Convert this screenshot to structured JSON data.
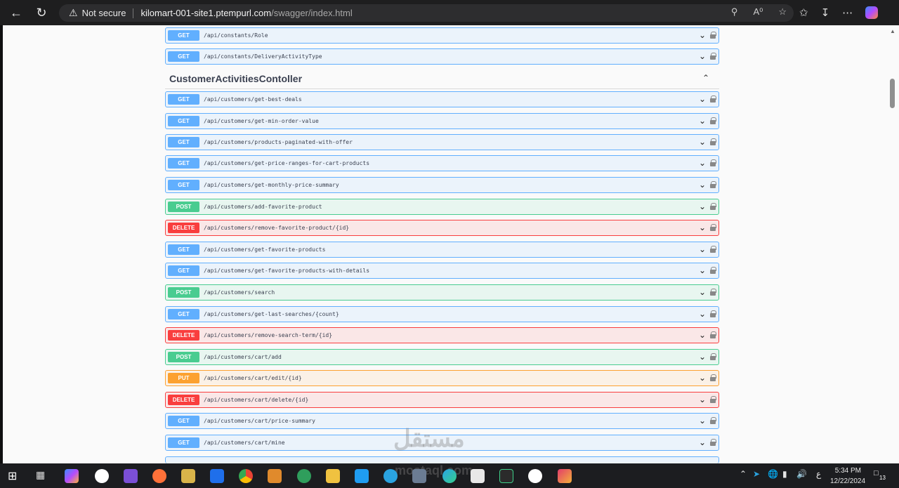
{
  "browser": {
    "not_secure": "Not secure",
    "url_host": "kilomart-001-site1.ptempurl.com",
    "url_path": "/swagger/index.html"
  },
  "top_ops": [
    {
      "method": "GET",
      "path": "/api/constants/Role"
    },
    {
      "method": "GET",
      "path": "/api/constants/DeliveryActivityType"
    }
  ],
  "section": {
    "title": "CustomerActivitiesContoller"
  },
  "ops": [
    {
      "method": "GET",
      "path": "/api/customers/get-best-deals"
    },
    {
      "method": "GET",
      "path": "/api/customers/get-min-order-value"
    },
    {
      "method": "GET",
      "path": "/api/customers/products-paginated-with-offer"
    },
    {
      "method": "GET",
      "path": "/api/customers/get-price-ranges-for-cart-products"
    },
    {
      "method": "GET",
      "path": "/api/customers/get-monthly-price-summary"
    },
    {
      "method": "POST",
      "path": "/api/customers/add-favorite-product"
    },
    {
      "method": "DELETE",
      "path": "/api/customers/remove-favorite-product/{id}"
    },
    {
      "method": "GET",
      "path": "/api/customers/get-favorite-products"
    },
    {
      "method": "GET",
      "path": "/api/customers/get-favorite-products-with-details"
    },
    {
      "method": "POST",
      "path": "/api/customers/search"
    },
    {
      "method": "GET",
      "path": "/api/customers/get-last-searches/{count}"
    },
    {
      "method": "DELETE",
      "path": "/api/customers/remove-search-term/{id}"
    },
    {
      "method": "POST",
      "path": "/api/customers/cart/add"
    },
    {
      "method": "PUT",
      "path": "/api/customers/cart/edit/{id}"
    },
    {
      "method": "DELETE",
      "path": "/api/customers/cart/delete/{id}"
    },
    {
      "method": "GET",
      "path": "/api/customers/cart/price-summary"
    },
    {
      "method": "GET",
      "path": "/api/customers/cart/mine"
    }
  ],
  "watermark": {
    "arabic": "مستقل",
    "latin": "mostaql.com"
  },
  "taskbar": {
    "time": "5:34 PM",
    "date": "12/22/2024",
    "lang": "ع",
    "notifications": "13"
  }
}
